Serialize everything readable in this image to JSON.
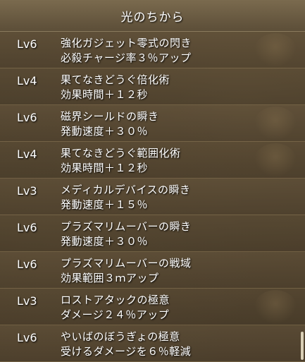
{
  "header": {
    "title": "光のちから"
  },
  "skills": [
    {
      "level": "Lv6",
      "name": "強化ガジェット零式の閃き",
      "effect": "必殺チャージ率３％アップ"
    },
    {
      "level": "Lv4",
      "name": "果てなきどうぐ倍化術",
      "effect": "効果時間＋１２秒"
    },
    {
      "level": "Lv6",
      "name": "磁界シールドの瞬き",
      "effect": "発動速度＋３０％"
    },
    {
      "level": "Lv4",
      "name": "果てなきどうぐ範囲化術",
      "effect": "効果時間＋１２秒"
    },
    {
      "level": "Lv3",
      "name": "メディカルデバイスの瞬き",
      "effect": "発動速度＋１５％"
    },
    {
      "level": "Lv6",
      "name": "プラズマリムーバーの瞬き",
      "effect": "発動速度＋３０％"
    },
    {
      "level": "Lv6",
      "name": "プラズマリムーバーの戦域",
      "effect": "効果範囲３ｍアップ"
    },
    {
      "level": "Lv3",
      "name": "ロストアタックの極意",
      "effect": "ダメージ２４％アップ"
    },
    {
      "level": "Lv6",
      "name": "やいばのぼうぎょの極意",
      "effect": "受けるダメージを６％軽減"
    }
  ]
}
